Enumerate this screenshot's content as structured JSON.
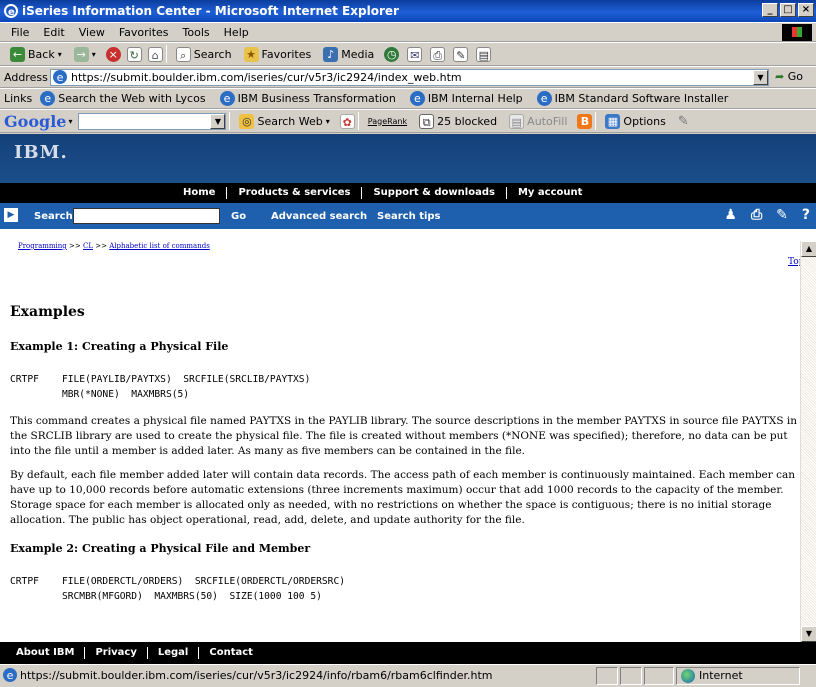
{
  "window": {
    "title": "iSeries Information Center - Microsoft Internet Explorer",
    "controls": [
      "_",
      "□",
      "×"
    ]
  },
  "menu": [
    "File",
    "Edit",
    "View",
    "Favorites",
    "Tools",
    "Help"
  ],
  "toolbar": {
    "back": "Back",
    "search": "Search",
    "favorites": "Favorites",
    "media": "Media"
  },
  "address": {
    "label": "Address",
    "url": "https://submit.boulder.ibm.com/iseries/cur/v5r3/ic2924/index_web.htm",
    "go": "Go"
  },
  "links": {
    "label": "Links",
    "items": [
      "Search the Web with Lycos",
      "IBM Business Transformation",
      "IBM Internal Help",
      "IBM Standard Software Installer"
    ]
  },
  "googlebar": {
    "logo": "Google",
    "search_web": "Search Web",
    "pagerank": "PageRank",
    "blocked": "25 blocked",
    "autofill": "AutoFill",
    "options": "Options"
  },
  "ibm": {
    "logo": "IBM.",
    "nav": [
      "Home",
      "Products & services",
      "Support & downloads",
      "My account"
    ],
    "search_label": "Search",
    "go": "Go",
    "advanced": "Advanced search",
    "tips": "Search tips"
  },
  "breadcrumb": {
    "items": [
      "Programming",
      "CL",
      "Alphabetic list of commands"
    ],
    "sep": ">>"
  },
  "top_link": "Top",
  "article": {
    "heading": "Examples",
    "ex1_title": "Example 1: Creating a Physical File",
    "ex1_code": "CRTPF    FILE(PAYLIB/PAYTXS)  SRCFILE(SRCLIB/PAYTXS)\n         MBR(*NONE)  MAXMBRS(5)",
    "ex1_p1": "This command creates a physical file named PAYTXS in the PAYLIB library. The source descriptions in the member PAYTXS in source file PAYTXS in the SRCLIB library are used to create the physical file. The file is created without members (*NONE was specified); therefore, no data can be put into the file until a member is added later. As many as five members can be contained in the file.",
    "ex1_p2": "By default, each file member added later will contain data records. The access path of each member is continuously maintained. Each member can have up to 10,000 records before automatic extensions (three increments maximum) occur that add 1000 records to the capacity of the member. Storage space for each member is allocated only as needed, with no restrictions on whether the space is contiguous; there is no initial storage allocation. The public has object operational, read, add, delete, and update authority for the file.",
    "ex2_title": "Example 2: Creating a Physical File and Member",
    "ex2_code": "CRTPF    FILE(ORDERCTL/ORDERS)  SRCFILE(ORDERCTL/ORDERSRC)\n         SRCMBR(MFGORD)  MAXMBRS(50)  SIZE(1000 100 5)"
  },
  "footer": [
    "About IBM",
    "Privacy",
    "Legal",
    "Contact"
  ],
  "status": {
    "url": "https://submit.boulder.ibm.com/iseries/cur/v5r3/ic2924/info/rbam6/rbam6clfinder.htm",
    "zone": "Internet"
  },
  "colors": {
    "ibm_header": "#1b4f8a",
    "search_bar": "#1e5fae",
    "link": "#0000cc"
  }
}
